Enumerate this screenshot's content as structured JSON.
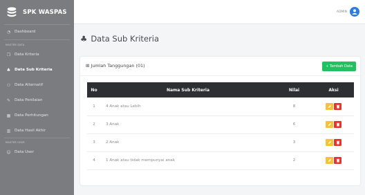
{
  "sidebar": {
    "brand": "SPK WASPAS",
    "items": [
      {
        "label": "Dashboard",
        "icon": "dashboard-icon"
      },
      {
        "label": "Data Kriteria",
        "icon": "cube-icon"
      },
      {
        "label": "Data Sub Kriteria",
        "icon": "cubes-icon"
      },
      {
        "label": "Data Alternatif",
        "icon": "users-icon"
      },
      {
        "label": "Data Penilaian",
        "icon": "edit-icon"
      },
      {
        "label": "Data Perhitungan",
        "icon": "calculator-icon"
      },
      {
        "label": "Data Hasil Akhir",
        "icon": "chart-icon"
      },
      {
        "label": "Data User",
        "icon": "user-icon"
      }
    ],
    "sections": [
      "MASTER DATA",
      "MASTER USER"
    ]
  },
  "topbar": {
    "user_label": "ADMIN"
  },
  "page": {
    "title": "Data Sub Kriteria"
  },
  "card": {
    "title": "Jumlah Tanggungan (01)",
    "add_button": "+ Tambah Data",
    "columns": [
      "No",
      "Nama Sub Kriteria",
      "Nilai",
      "Aksi"
    ],
    "rows": [
      {
        "no": "1",
        "name": "4 Anak atau Lebih",
        "nilai": "8"
      },
      {
        "no": "2",
        "name": "3 Anak",
        "nilai": "6"
      },
      {
        "no": "3",
        "name": "2 Anak",
        "nilai": "3"
      },
      {
        "no": "4",
        "name": "1 Anak atau tidak mempunyai anak",
        "nilai": "2"
      }
    ]
  },
  "colors": {
    "sidebar": "#7b7c80",
    "header": "#2e2f33",
    "add": "#1fc25f",
    "edit": "#f7c23a",
    "delete": "#e8332d",
    "avatar": "#2a7de1"
  }
}
